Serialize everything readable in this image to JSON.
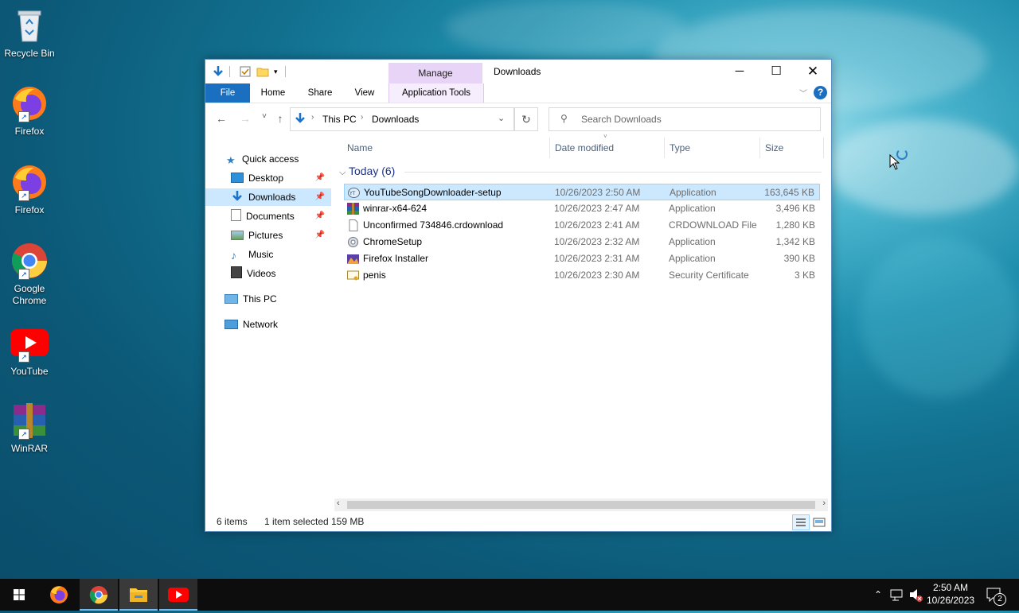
{
  "desktop": {
    "icons": [
      {
        "label": "Recycle Bin"
      },
      {
        "label": "Firefox"
      },
      {
        "label": "Firefox"
      },
      {
        "label": "Google Chrome"
      },
      {
        "label": "YouTube"
      },
      {
        "label": "WinRAR"
      }
    ]
  },
  "window": {
    "title": "Downloads",
    "manage_tab": "Manage",
    "ribbon_tabs": [
      "File",
      "Home",
      "Share",
      "View",
      "Application Tools"
    ],
    "address": {
      "crumbs": [
        "This PC",
        "Downloads"
      ]
    },
    "search": {
      "placeholder": "Search Downloads"
    },
    "nav": [
      {
        "label": "Quick access"
      },
      {
        "label": "Desktop"
      },
      {
        "label": "Downloads"
      },
      {
        "label": "Documents"
      },
      {
        "label": "Pictures"
      },
      {
        "label": "Music"
      },
      {
        "label": "Videos"
      },
      {
        "label": "This PC"
      },
      {
        "label": "Network"
      }
    ],
    "columns": [
      "Name",
      "Date modified",
      "Type",
      "Size"
    ],
    "group": "Today (6)",
    "files": [
      {
        "name": "YouTubeSongDownloader-setup",
        "date": "10/26/2023 2:50 AM",
        "type": "Application",
        "size": "163,645 KB",
        "selected": true
      },
      {
        "name": "winrar-x64-624",
        "date": "10/26/2023 2:47 AM",
        "type": "Application",
        "size": "3,496 KB"
      },
      {
        "name": "Unconfirmed 734846.crdownload",
        "date": "10/26/2023 2:41 AM",
        "type": "CRDOWNLOAD File",
        "size": "1,280 KB"
      },
      {
        "name": "ChromeSetup",
        "date": "10/26/2023 2:32 AM",
        "type": "Application",
        "size": "1,342 KB"
      },
      {
        "name": "Firefox Installer",
        "date": "10/26/2023 2:31 AM",
        "type": "Application",
        "size": "390 KB"
      },
      {
        "name": "penis",
        "date": "10/26/2023 2:30 AM",
        "type": "Security Certificate",
        "size": "3 KB"
      }
    ],
    "status": {
      "count": "6 items",
      "selected": "1 item selected",
      "size": "159 MB"
    }
  },
  "taskbar": {
    "time": "2:50 AM",
    "date": "10/26/2023",
    "notifications": "2"
  }
}
